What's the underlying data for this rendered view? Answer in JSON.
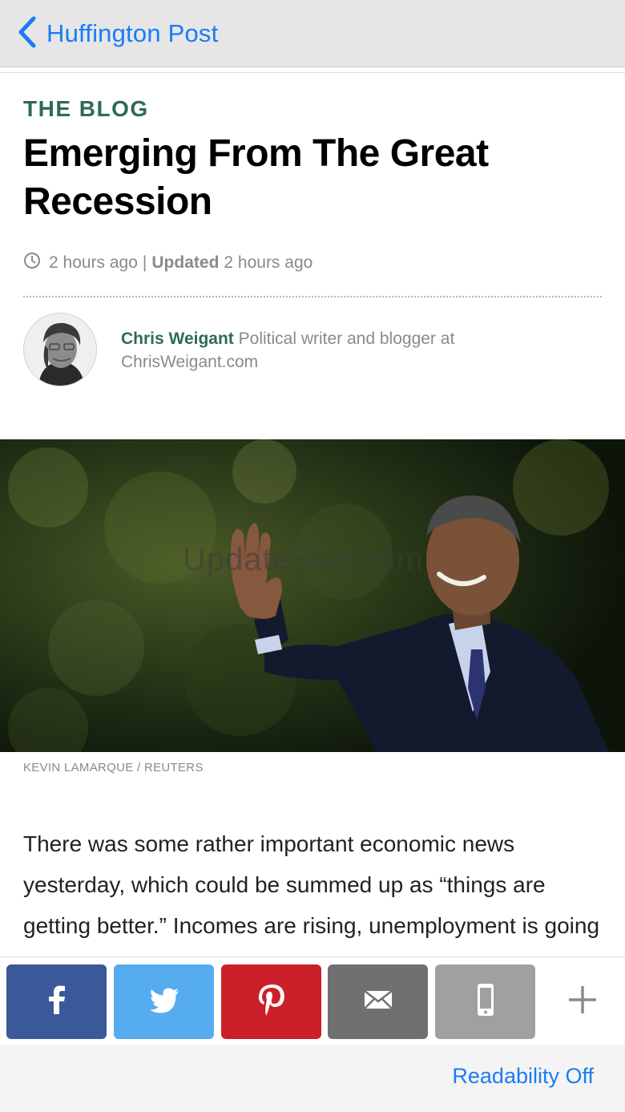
{
  "nav": {
    "back_label": "Huffington Post"
  },
  "article": {
    "kicker": "THE BLOG",
    "headline": "Emerging From The Great Recession",
    "meta": {
      "posted": "2 hours ago",
      "separator": "|",
      "updated_label": "Updated",
      "updated": "2 hours ago"
    },
    "author": {
      "name": "Chris Weigant",
      "bio": "Political writer and blogger at ChrisWeigant.com"
    },
    "photo": {
      "watermark": "UpdateStar.com",
      "credit": "KEVIN LAMARQUE / REUTERS"
    },
    "body": "There was some rather important economic news yesterday, which could be summed up as “things are getting better.”  Incomes are rising, unemployment is going down, and the number of poor people has decreased."
  },
  "share": {
    "buttons": [
      {
        "name": "facebook",
        "icon": "facebook-icon",
        "color": "#3b5998"
      },
      {
        "name": "twitter",
        "icon": "twitter-icon",
        "color": "#55acee"
      },
      {
        "name": "pinterest",
        "icon": "pinterest-icon",
        "color": "#cb2027"
      },
      {
        "name": "email",
        "icon": "mail-icon",
        "color": "#707070"
      },
      {
        "name": "sms",
        "icon": "phone-icon",
        "color": "#a0a0a0"
      },
      {
        "name": "more",
        "icon": "plus-icon"
      }
    ]
  },
  "toolbar": {
    "readability_label": "Readability Off"
  },
  "colors": {
    "accent": "#1a7cf5",
    "section": "#2e6b55"
  }
}
